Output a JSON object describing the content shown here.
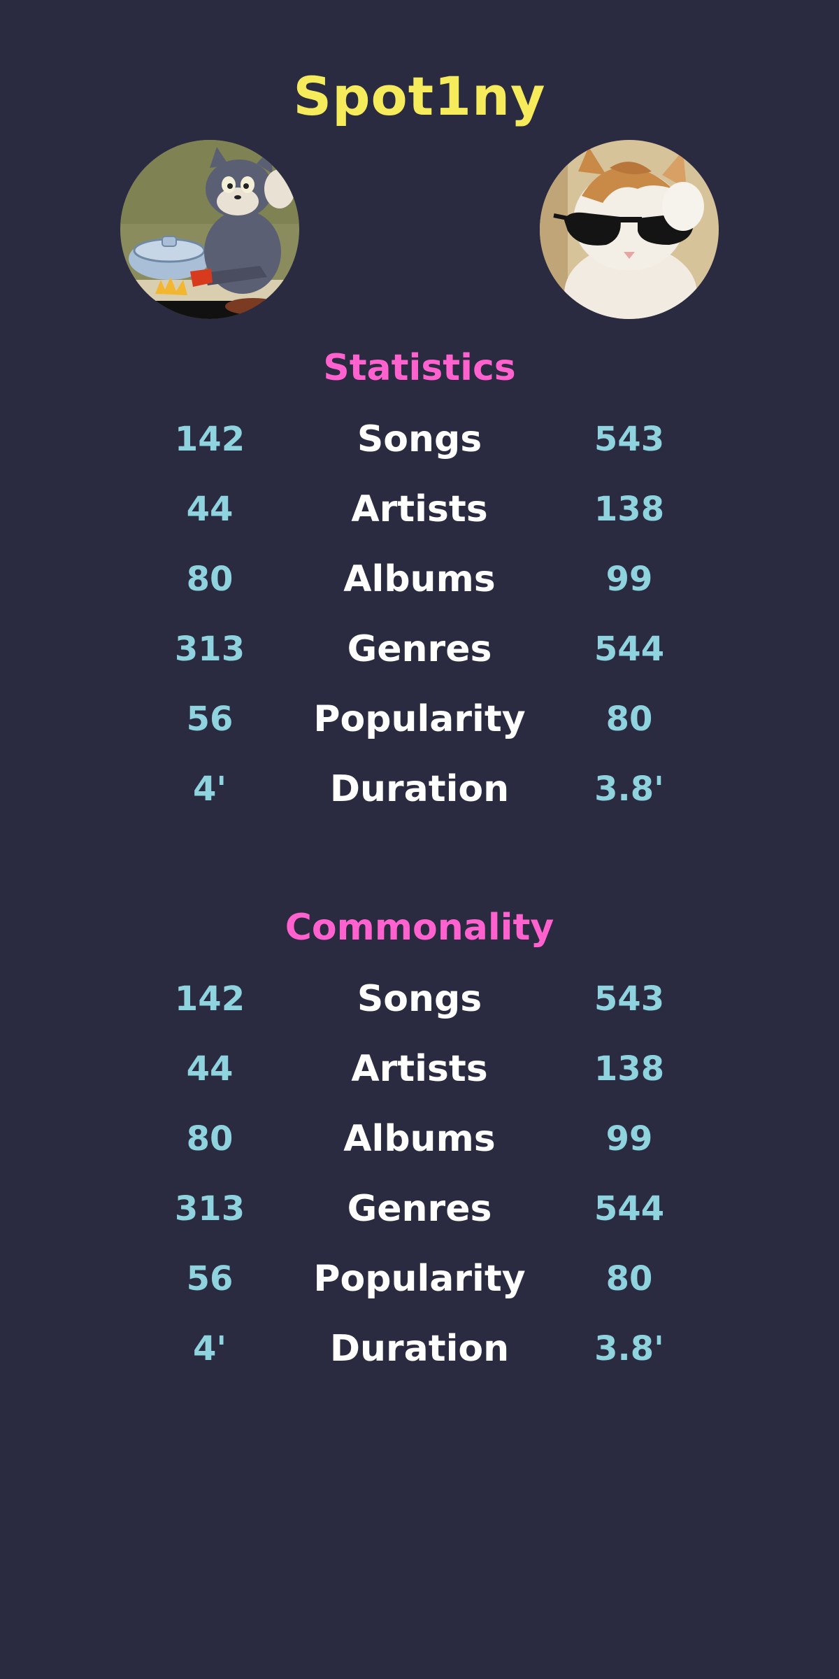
{
  "app": {
    "title": "Spot1ny"
  },
  "avatars": {
    "left": {
      "icon": "cartoon-cat-cooking-avatar"
    },
    "right": {
      "icon": "cat-sunglasses-avatar"
    }
  },
  "colors": {
    "background": "#2a2b40",
    "title": "#f5eb5b",
    "section_heading": "#ff62cf",
    "value": "#8fd3de",
    "label": "#ffffff"
  },
  "statistics": {
    "heading": "Statistics",
    "rows": [
      {
        "left": "142",
        "label": "Songs",
        "right": "543"
      },
      {
        "left": "44",
        "label": "Artists",
        "right": "138"
      },
      {
        "left": "80",
        "label": "Albums",
        "right": "99"
      },
      {
        "left": "313",
        "label": "Genres",
        "right": "544"
      },
      {
        "left": "56",
        "label": "Popularity",
        "right": "80"
      },
      {
        "left": "4'",
        "label": "Duration",
        "right": "3.8'"
      }
    ]
  },
  "commonality": {
    "heading": "Commonality",
    "rows": [
      {
        "left": "142",
        "label": "Songs",
        "right": "543"
      },
      {
        "left": "44",
        "label": "Artists",
        "right": "138"
      },
      {
        "left": "80",
        "label": "Albums",
        "right": "99"
      },
      {
        "left": "313",
        "label": "Genres",
        "right": "544"
      },
      {
        "left": "56",
        "label": "Popularity",
        "right": "80"
      },
      {
        "left": "4'",
        "label": "Duration",
        "right": "3.8'"
      }
    ]
  }
}
